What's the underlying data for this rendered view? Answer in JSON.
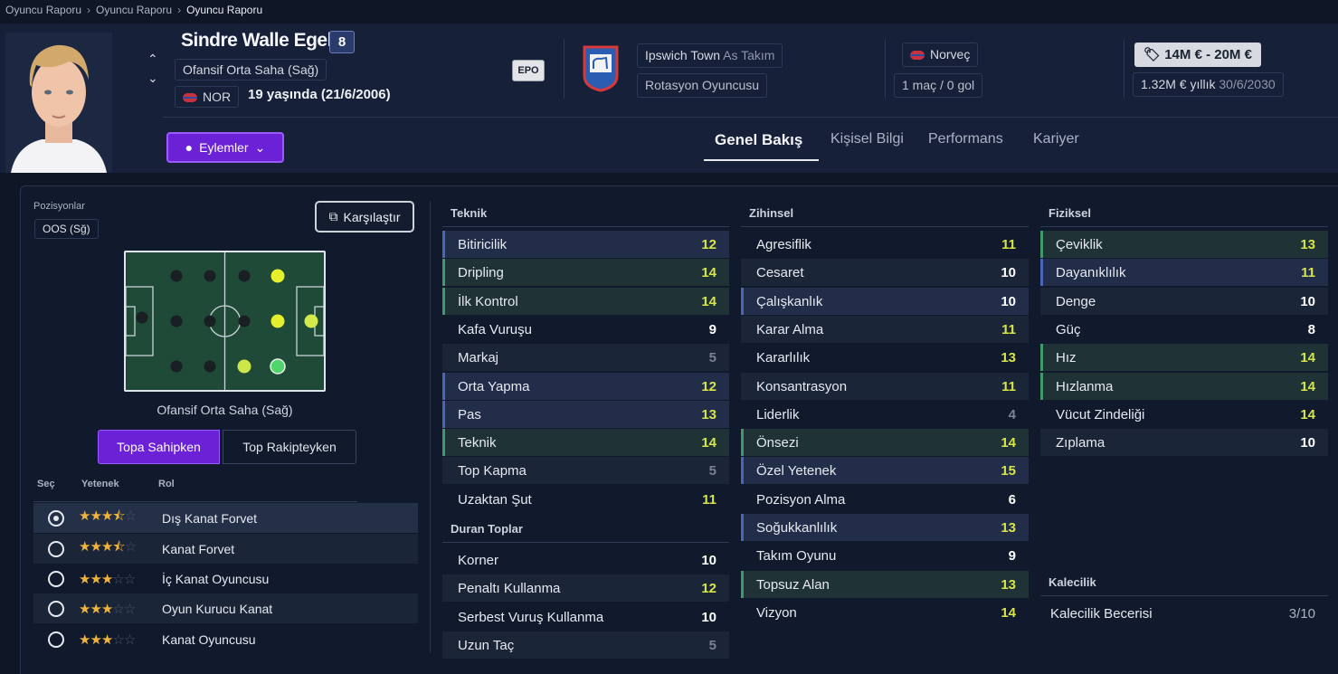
{
  "breadcrumb": [
    "Oyuncu Raporu",
    "Oyuncu Raporu",
    "Oyuncu Raporu"
  ],
  "player": {
    "name": "Sindre Walle Egeli",
    "shirt_number": "8",
    "position": "Ofansif Orta Saha (Sağ)",
    "nationality_code": "NOR",
    "age_text": "19 yaşında (21/6/2006)",
    "epo_badge": "EPO",
    "club": "Ipswich Town",
    "club_status": "As Takım",
    "squad_role": "Rotasyon Oyuncusu",
    "nation": "Norveç",
    "caps": "1 maç / 0 gol",
    "value": "14M € - 20M €",
    "wage": "1.32M € yıllık",
    "contract_end": "30/6/2030"
  },
  "actions_label": "Eylemler",
  "tabs": [
    "Genel Bakış",
    "Kişisel Bilgi",
    "Performans",
    "Kariyer"
  ],
  "positions": {
    "title": "Pozisyonlar",
    "chip": "OOS (Sğ)",
    "compare_label": "Karşılaştır",
    "pitch_label": "Ofansif Orta Saha (Sağ)",
    "toggle_in_possession": "Topa Sahipken",
    "toggle_out_possession": "Top Rakipteyken"
  },
  "roles": {
    "headers": [
      "Seç",
      "Yetenek",
      "Rol"
    ],
    "items": [
      {
        "name": "Dış Kanat Forvet",
        "stars": 3.5,
        "selected": true
      },
      {
        "name": "Kanat Forvet",
        "stars": 3.5,
        "selected": false
      },
      {
        "name": "İç Kanat Oyuncusu",
        "stars": 3,
        "selected": false
      },
      {
        "name": "Oyun Kurucu Kanat",
        "stars": 3,
        "selected": false
      },
      {
        "name": "Kanat Oyuncusu",
        "stars": 3,
        "selected": false
      }
    ]
  },
  "attributes": {
    "technical": {
      "title": "Teknik",
      "items": [
        {
          "name": "Bitiricilik",
          "value": "12"
        },
        {
          "name": "Dripling",
          "value": "14"
        },
        {
          "name": "İlk Kontrol",
          "value": "14"
        },
        {
          "name": "Kafa Vuruşu",
          "value": "9"
        },
        {
          "name": "Markaj",
          "value": "5"
        },
        {
          "name": "Orta Yapma",
          "value": "12"
        },
        {
          "name": "Pas",
          "value": "13"
        },
        {
          "name": "Teknik",
          "value": "14"
        },
        {
          "name": "Top Kapma",
          "value": "5"
        },
        {
          "name": "Uzaktan Şut",
          "value": "11"
        }
      ]
    },
    "set_pieces": {
      "title": "Duran Toplar",
      "items": [
        {
          "name": "Korner",
          "value": "10"
        },
        {
          "name": "Penaltı Kullanma",
          "value": "12"
        },
        {
          "name": "Serbest Vuruş Kullanma",
          "value": "10"
        },
        {
          "name": "Uzun Taç",
          "value": "5"
        }
      ]
    },
    "mental": {
      "title": "Zihinsel",
      "items": [
        {
          "name": "Agresiflik",
          "value": "11"
        },
        {
          "name": "Cesaret",
          "value": "10"
        },
        {
          "name": "Çalışkanlık",
          "value": "10"
        },
        {
          "name": "Karar Alma",
          "value": "11"
        },
        {
          "name": "Kararlılık",
          "value": "13"
        },
        {
          "name": "Konsantrasyon",
          "value": "11"
        },
        {
          "name": "Liderlik",
          "value": "4"
        },
        {
          "name": "Önsezi",
          "value": "14"
        },
        {
          "name": "Özel Yetenek",
          "value": "15"
        },
        {
          "name": "Pozisyon Alma",
          "value": "6"
        },
        {
          "name": "Soğukkanlılık",
          "value": "13"
        },
        {
          "name": "Takım Oyunu",
          "value": "9"
        },
        {
          "name": "Topsuz Alan",
          "value": "13"
        },
        {
          "name": "Vizyon",
          "value": "14"
        }
      ]
    },
    "physical": {
      "title": "Fiziksel",
      "items": [
        {
          "name": "Çeviklik",
          "value": "13"
        },
        {
          "name": "Dayanıklılık",
          "value": "11"
        },
        {
          "name": "Denge",
          "value": "10"
        },
        {
          "name": "Güç",
          "value": "8"
        },
        {
          "name": "Hız",
          "value": "14"
        },
        {
          "name": "Hızlanma",
          "value": "14"
        },
        {
          "name": "Vücut Zindeliği",
          "value": "14"
        },
        {
          "name": "Zıplama",
          "value": "10"
        }
      ]
    },
    "goalkeeping": {
      "title": "Kalecilik",
      "label": "Kalecilik Becerisi",
      "value": "3/10"
    }
  },
  "colors": {
    "accent": "#6b21d6",
    "value_high": "#d7e54a",
    "value_low": "#7a8294"
  }
}
